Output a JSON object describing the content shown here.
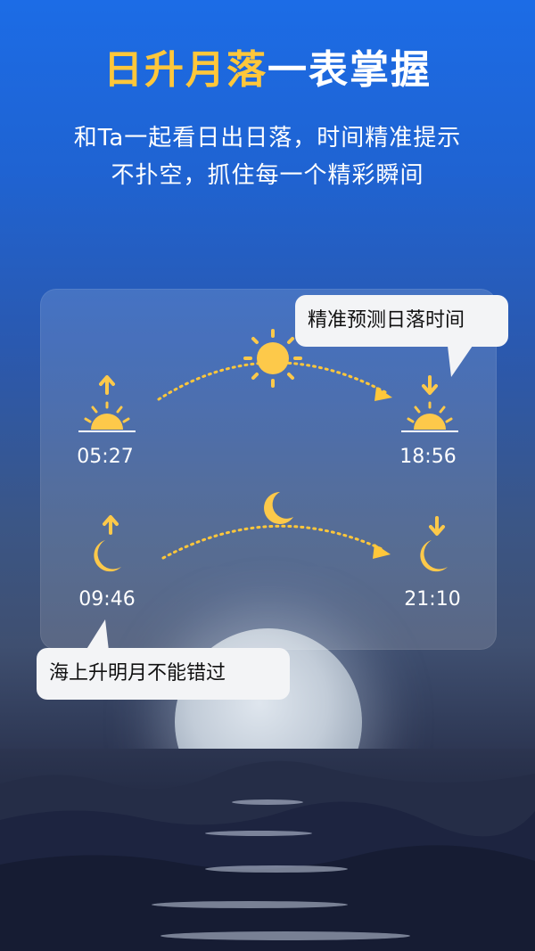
{
  "headline": {
    "highlight": "日升月落",
    "rest": "一表掌握"
  },
  "subtitle": {
    "line1": "和Ta一起看日出日落，时间精准提示",
    "line2": "不扑空，抓住每一个精彩瞬间"
  },
  "sun": {
    "rise_time": "05:27",
    "set_time": "18:56"
  },
  "moon": {
    "rise_time": "09:46",
    "set_time": "21:10"
  },
  "callouts": {
    "sunset_tip": "精准预测日落时间",
    "moonrise_tip": "海上升明月不能错过"
  },
  "colors": {
    "accent_yellow": "#ffc73a",
    "sun_yellow": "#fdc94a"
  }
}
